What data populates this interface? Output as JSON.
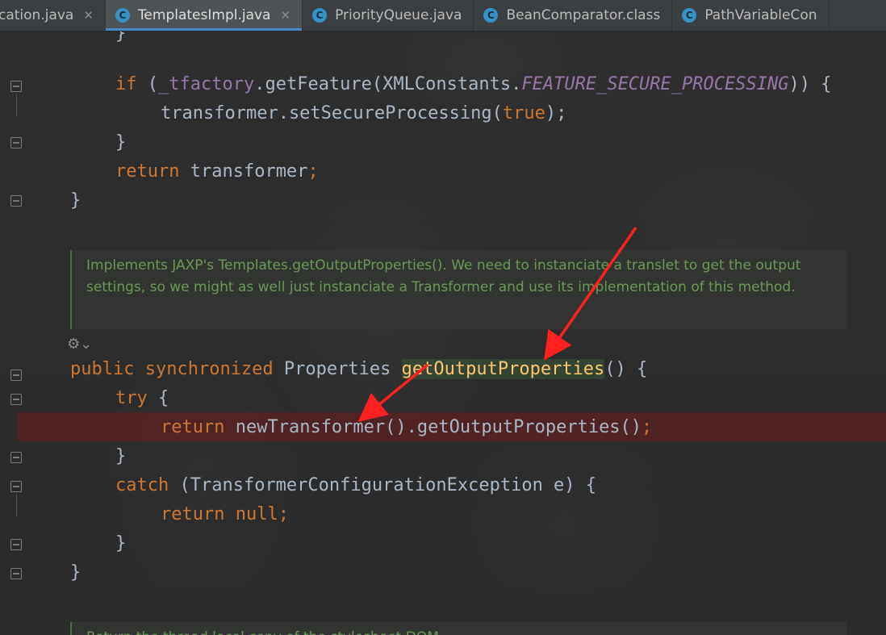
{
  "tabs": [
    {
      "label": "cation.java",
      "icon": "none",
      "active": false
    },
    {
      "label": "TemplatesImpl.java",
      "icon": "class-icon",
      "active": true
    },
    {
      "label": "PriorityQueue.java",
      "icon": "class-icon",
      "active": false
    },
    {
      "label": "BeanComparator.class",
      "icon": "class-icon",
      "active": false
    },
    {
      "label": "PathVariableCon",
      "icon": "class-icon",
      "active": false
    }
  ],
  "tab_close_glyph": "✕",
  "class_icon_letter": "C",
  "code": {
    "l0": "}",
    "l1_kw": "if",
    "l1_a": " (",
    "l1_fld": "_tfactory",
    "l1_b": ".getFeature(XMLConstants.",
    "l1_cst": "FEATURE_SECURE_PROCESSING",
    "l1_c": ")) {",
    "l2_a": "transformer.setSecureProcessing(",
    "l2_kw": "true",
    "l2_b": ");",
    "l3": "}",
    "l4_kw": "return",
    "l4_a": " transformer",
    "l4_b": ";",
    "l5": "}",
    "l6_kw1": "public",
    "l6_kw2": "synchronized",
    "l6_a": " Properties ",
    "l6_fn": "getOutputProperties",
    "l6_b": "() {",
    "l7_kw": "try",
    "l7_a": " {",
    "l8_kw": "return",
    "l8_a": " newTransformer().getOutputProperties()",
    "l8_b": ";",
    "l9": "}",
    "l10_kw": "catch",
    "l10_a": " (TransformerConfigurationException e) {",
    "l11_kw": "return",
    "l11_kw2": "null",
    "l11_b": ";",
    "l12": "}",
    "l13": "}"
  },
  "doc_comment_1": "Implements JAXP's Templates.getOutputProperties(). We need to instanciate a translet to get the output settings, so we might as well just instanciate a Transformer and use its implementation of this method.",
  "doc_comment_2": "Return the thread local copy of the stylesheet DOM.",
  "gutter_marker": "⚙⌄",
  "colors": {
    "keyword": "#cc7832",
    "field": "#9876aa",
    "method": "#ffc66d",
    "doc_comment": "#6a9955",
    "breakpoint_line": "#6e1e1e",
    "annotation_arrow": "#ff2020"
  }
}
